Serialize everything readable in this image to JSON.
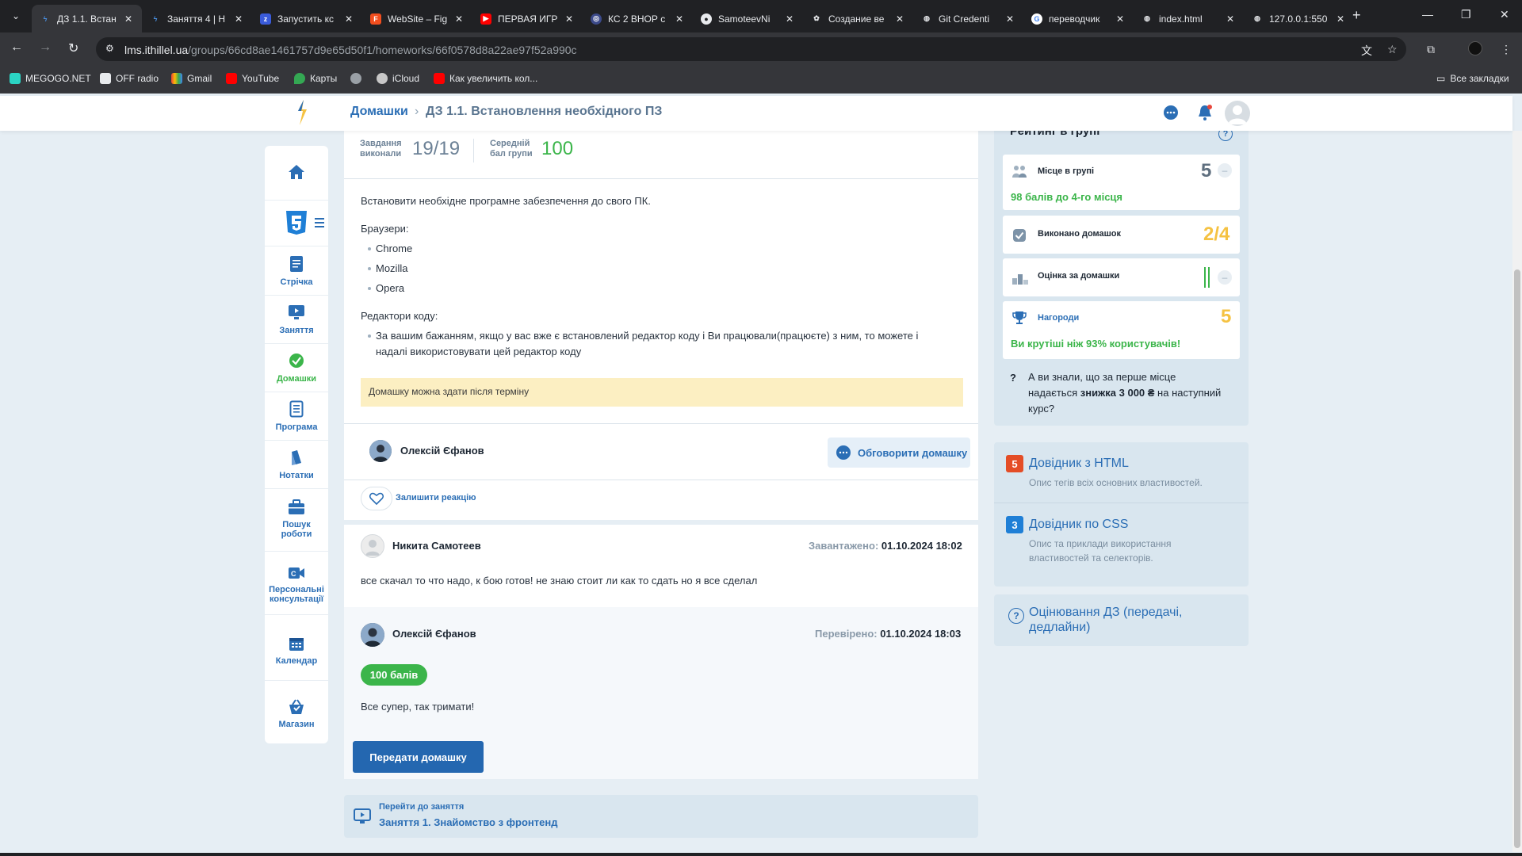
{
  "browser": {
    "tabs": [
      {
        "title": "ДЗ 1.1. Встан",
        "active": true
      },
      {
        "title": "Заняття 4 | Н"
      },
      {
        "title": "Запустить кс"
      },
      {
        "title": "WebSite – Fig"
      },
      {
        "title": "ПЕРВАЯ ИГР"
      },
      {
        "title": "КС 2 ВНОР с"
      },
      {
        "title": "SamoteevNi"
      },
      {
        "title": "Создание ве"
      },
      {
        "title": "Git Credenti"
      },
      {
        "title": "переводчик"
      },
      {
        "title": "index.html"
      },
      {
        "title": "127.0.0.1:550"
      }
    ],
    "url_host": "lms.ithillel.ua",
    "url_path": "/groups/66cd8ae1461757d9e65d50f1/homeworks/66f0578d8a22ae97f52a990c",
    "bookmarks": [
      "MEGOGO.NET",
      "OFF radio",
      "Gmail",
      "YouTube",
      "Карты",
      "",
      "iCloud",
      "Как увеличить кол..."
    ],
    "all_bookmarks": "Все закладки"
  },
  "header": {
    "breadcrumb_home": "Домашки",
    "breadcrumb_current": "ДЗ 1.1. Встановлення необхідного ПЗ"
  },
  "sidebar": {
    "items": [
      {
        "label": "Стрічка"
      },
      {
        "label": "Заняття"
      },
      {
        "label": "Домашки"
      },
      {
        "label": "Програма"
      },
      {
        "label": "Нотатки"
      },
      {
        "label": "Пошук роботи"
      },
      {
        "label": "Персональні консультації"
      },
      {
        "label": "Календар"
      },
      {
        "label": "Магазин"
      }
    ]
  },
  "main": {
    "stats": {
      "done_label": "Завдання виконали",
      "done_value": "19/19",
      "avg_label": "Середній бал групи",
      "avg_value": "100"
    },
    "intro": "Встановити необхідне програмне забезпечення до свого ПК.",
    "browsers_title": "Браузери:",
    "browsers": [
      "Chrome",
      "Mozilla",
      "Opera"
    ],
    "editors_title": "Редактори коду:",
    "editors_note_1": "За вашим бажанням, якщо у вас вже є встановлений редактор коду і Ви працювали(працюєте) з ним, то можете і",
    "editors_note_2": "надалі використовувати цей редактор коду",
    "notice": "Домашку можна здати після терміну",
    "author_name": "Олексій Єфанов",
    "discuss_label": "Обговорити домашку",
    "react_label": "Залишити реакцію",
    "submission": {
      "name": "Никита Самотеев",
      "meta_label": "Завантажено:",
      "meta_value": "01.10.2024 18:02",
      "text": "все скачал то что надо, к бою готов! не знаю стоит ли как то сдать но я все сделал"
    },
    "review": {
      "name": "Олексій Єфанов",
      "meta_label": "Перевірено:",
      "meta_value": "01.10.2024 18:03",
      "score": "100 балів",
      "text": "Все супер, так тримати!"
    },
    "submit_label": "Передати домашку",
    "goto_sub": "Перейти до заняття",
    "goto_title": "Заняття 1. Знайомство з фронтенд"
  },
  "rating": {
    "title": "Рейтинг в групі",
    "place_label": "Місце в групі",
    "place_value": "5",
    "place_note": "98 балів до 4-го місця",
    "hw_label": "Виконано домашок",
    "hw_value": "2/4",
    "grade_label": "Оцінка за домашки",
    "awards_label": "Нагороди",
    "awards_value": "5",
    "awards_note": "Ви крутіші ніж 93% користувачів!",
    "promo_1": "А ви знали, що за перше місце надається ",
    "promo_bold": "знижка 3 000 ₴",
    "promo_2": " на наступний курс?"
  },
  "refs": [
    {
      "title": "Довідник з HTML",
      "desc": "Опис тегів всіх основних властивостей."
    },
    {
      "title": "Довідник по CSS",
      "desc": "Опис та приклади використання властивостей та селекторів."
    },
    {
      "title": "Оцінювання ДЗ (передачі, дедлайни)"
    }
  ],
  "colors": {
    "brand_blue": "#2b6eb5",
    "accent_green": "#3bb54a",
    "accent_yellow": "#f5c242",
    "page_bg": "#e6eef4"
  }
}
